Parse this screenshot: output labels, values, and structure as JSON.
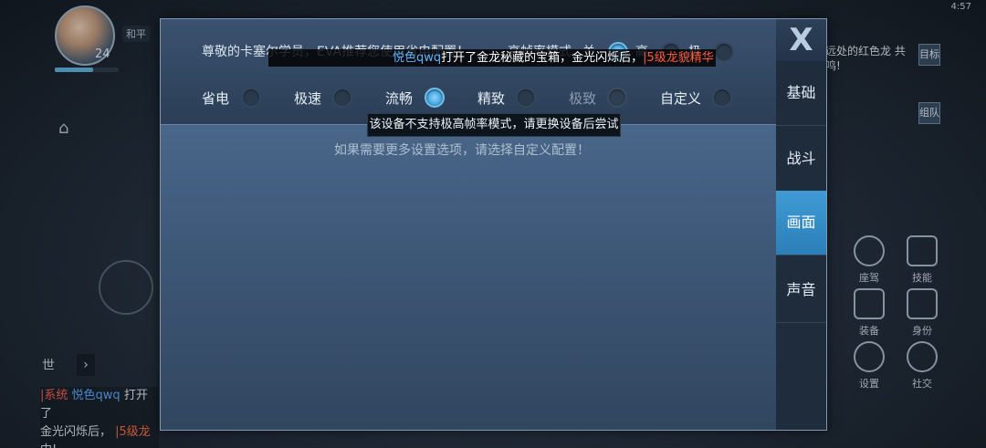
{
  "hud": {
    "level": "24",
    "player_tag": "和平",
    "chat_tab": "世",
    "chat_arrow": "›",
    "chat": {
      "system": "|系统",
      "name": "悦色qwq",
      "text1": "打开了",
      "text2": "金光闪烁后，",
      "item": "|5级龙",
      "text3": "中!"
    },
    "status": "4:57",
    "right_quest": "远处的红色龙\n共鸣!",
    "right_tab_top": "目标",
    "right_tab_bottom": "组队",
    "buttons": [
      "座驾",
      "技能",
      "装备",
      "身份",
      "设置",
      "社交"
    ]
  },
  "modal": {
    "notice": "尊敬的卡塞尔学员，EVA推荐您使用省电配置！",
    "fps_label": "高帧率模式",
    "fps_options": [
      {
        "label": "关",
        "selected": true
      },
      {
        "label": "高",
        "selected": false
      },
      {
        "label": "极",
        "selected": false
      }
    ],
    "presets": [
      {
        "label": "省电",
        "selected": false,
        "disabled": false
      },
      {
        "label": "极速",
        "selected": false,
        "disabled": false
      },
      {
        "label": "流畅",
        "selected": true,
        "disabled": false
      },
      {
        "label": "精致",
        "selected": false,
        "disabled": false
      },
      {
        "label": "极致",
        "selected": false,
        "disabled": true
      },
      {
        "label": "自定义",
        "selected": false,
        "disabled": false
      }
    ],
    "hint": "如果需要更多设置选项，请选择自定义配置！",
    "close_label": "X",
    "tabs": [
      {
        "label": "基础",
        "active": false
      },
      {
        "label": "战斗",
        "active": false
      },
      {
        "label": "画面",
        "active": true
      },
      {
        "label": "声音",
        "active": false
      }
    ]
  },
  "broadcast": {
    "who": "悦色qwq",
    "what": "打开了金龙秘藏的宝箱，金光闪烁后，",
    "loot": "|5级龙貌精华"
  },
  "tooltip": "该设备不支持极高帧率模式，请更换设备后尝试"
}
